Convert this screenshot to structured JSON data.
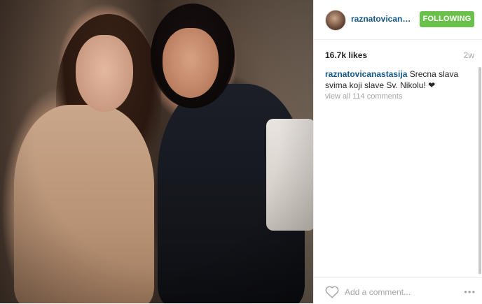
{
  "post": {
    "username_short": "raznatovicanas...",
    "username": "raznatovicanastasija",
    "follow_label": "FOLLOWING",
    "likes": "16.7k likes",
    "age": "2w",
    "caption": "Srecna slava svima koji slave Sv. Nikolu! ❤",
    "view_all": "view all 114 comments",
    "comment_placeholder": "Add a comment...",
    "more_label": "•••"
  },
  "colors": {
    "following_button": "#6bc04b",
    "username_link": "#125688",
    "muted_text": "#a5a7aa"
  },
  "icons": {
    "like": "heart-outline-icon",
    "more": "more-options-icon"
  }
}
